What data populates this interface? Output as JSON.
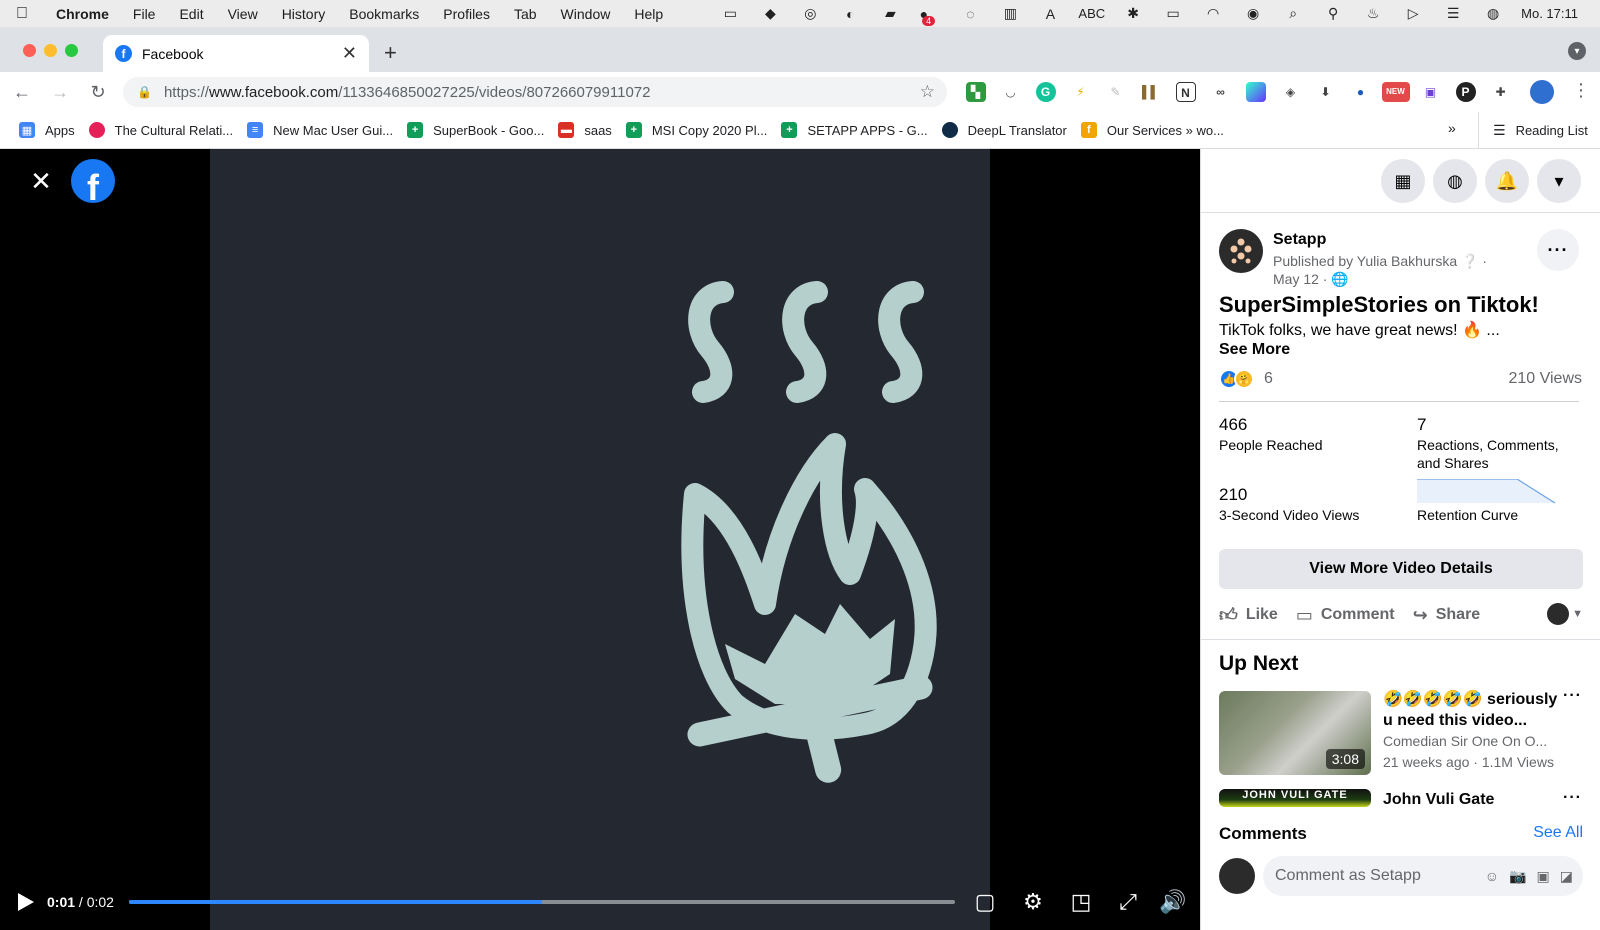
{
  "menubar": {
    "app": "Chrome",
    "items": [
      "File",
      "Edit",
      "View",
      "History",
      "Bookmarks",
      "Profiles",
      "Tab",
      "Window",
      "Help"
    ],
    "notification_count": "4",
    "abc_label": "ABC",
    "clock": "Mo. 17:11"
  },
  "browser": {
    "tab_title": "Facebook",
    "url_prefix": "https://",
    "url_host": "www.facebook.com",
    "url_path": "/1133646850027225/videos/807266079911072",
    "new_badge": "NEW"
  },
  "bookmarks": {
    "items": [
      {
        "label": "Apps",
        "color": "#4285f4"
      },
      {
        "label": "The Cultural Relati...",
        "color": "#e6215a"
      },
      {
        "label": "New Mac User Gui...",
        "color": "#4285f4"
      },
      {
        "label": "SuperBook - Goo...",
        "color": "#0f9d58"
      },
      {
        "label": "saas",
        "color": "#d93025"
      },
      {
        "label": "MSI Copy 2020 Pl...",
        "color": "#0f9d58"
      },
      {
        "label": "SETAPP APPS - G...",
        "color": "#0f9d58"
      },
      {
        "label": "DeepL Translator",
        "color": "#0f2b46"
      },
      {
        "label": "Our Services » wo...",
        "color": "#f0a500"
      }
    ],
    "more": "»",
    "reading_list": "Reading List"
  },
  "video": {
    "current_time": "0:01",
    "duration": "0:02",
    "progress_fraction": 0.5
  },
  "post": {
    "page_name": "Setapp",
    "published_by": "Published by Yulia Bakhurska",
    "date": "May 12 ·",
    "title": "SuperSimpleStories on Tiktok!",
    "text": "TikTok folks, we have great news! 🔥 ...",
    "see_more": "See More",
    "reaction_count": "6",
    "views": "210 Views",
    "stats": {
      "reached_value": "466",
      "reached_label": "People Reached",
      "engagement_value": "7",
      "engagement_label": "Reactions, Comments, and Shares",
      "video_views_value": "210",
      "video_views_label": "3-Second Video Views",
      "retention_label": "Retention Curve"
    },
    "details_button": "View More Video Details",
    "actions": {
      "like": "Like",
      "comment": "Comment",
      "share": "Share"
    }
  },
  "up_next": {
    "title": "Up Next",
    "videos": [
      {
        "title": "🤣🤣🤣🤣🤣 seriously u need this video...",
        "channel": "Comedian Sir One On O...",
        "meta": "21 weeks ago · 1.1M Views",
        "duration": "3:08"
      },
      {
        "title": "John Vuli Gate",
        "thumb_caption": "JOHN VULI GATE"
      }
    ]
  },
  "comments": {
    "title": "Comments",
    "see_all": "See All",
    "placeholder": "Comment as Setapp"
  }
}
